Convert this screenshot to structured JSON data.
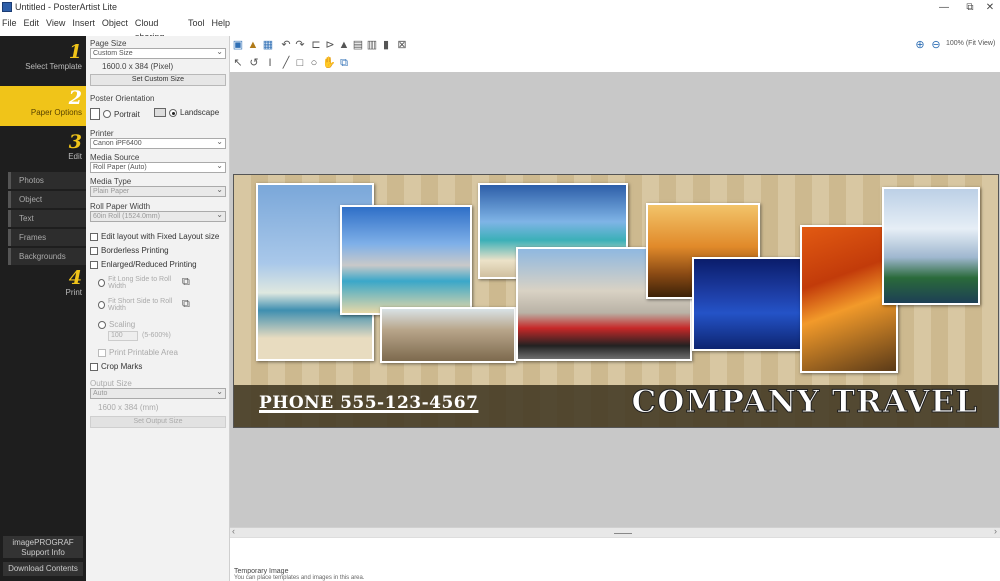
{
  "window": {
    "title": "Untitled - PosterArtist Lite",
    "min_label": "—",
    "max_label": "⧉",
    "close_label": "✕"
  },
  "menu": [
    "File",
    "Edit",
    "View",
    "Insert",
    "Object",
    "Cloud sharing",
    "Tool",
    "Help"
  ],
  "steps": [
    {
      "num": "1",
      "label": "Select Template"
    },
    {
      "num": "2",
      "label": "Paper Options"
    },
    {
      "num": "3",
      "label": "Edit"
    },
    {
      "num": "4",
      "label": "Print"
    }
  ],
  "edit_items": [
    "Photos",
    "Object",
    "Text",
    "Frames",
    "Backgrounds"
  ],
  "bottom_buttons": {
    "support": "imagePROGRAF Support Info",
    "download": "Download Contents"
  },
  "paper_options": {
    "page_size_label": "Page Size",
    "page_size_value": "Custom Size",
    "page_size_dims": "1600.0 x 384 (Pixel)",
    "set_custom_size": "Set Custom Size",
    "orientation_label": "Poster Orientation",
    "portrait": "Portrait",
    "landscape": "Landscape",
    "printer_label": "Printer",
    "printer_value": "Canon iPF6400",
    "media_source_label": "Media Source",
    "media_source_value": "Roll Paper (Auto)",
    "media_type_label": "Media Type",
    "media_type_value": "Plain Paper",
    "roll_width_label": "Roll Paper Width",
    "roll_width_value": "60in Roll (1524.0mm)",
    "edit_layout": "Edit layout with Fixed Layout size",
    "borderless": "Borderless Printing",
    "enlarged": "Enlarged/Reduced Printing",
    "fit_long": "Fit Long Side to Roll Width",
    "fit_short": "Fit Short Side to Roll Width",
    "scaling": "Scaling",
    "scaling_value": "100",
    "scaling_range": "(5-600%)",
    "print_area": "Print Printable Area",
    "crop_marks": "Crop Marks",
    "output_label": "Output Size",
    "output_value": "Auto",
    "output_dims": "1600 x 384 (mm)",
    "output_btn": "Set Output Size"
  },
  "zoom": {
    "value": "100% (Fit View)"
  },
  "poster": {
    "phone": "PHONE 555-123-4567",
    "company": "COMPANY TRAVEL"
  },
  "footer": {
    "line1": "Temporary Image",
    "line2": "You can place templates and images in this area."
  },
  "colors": {
    "accent": "#f0c419",
    "nav_bg": "#1e1e1e",
    "workspace": "#c8c8c8"
  }
}
